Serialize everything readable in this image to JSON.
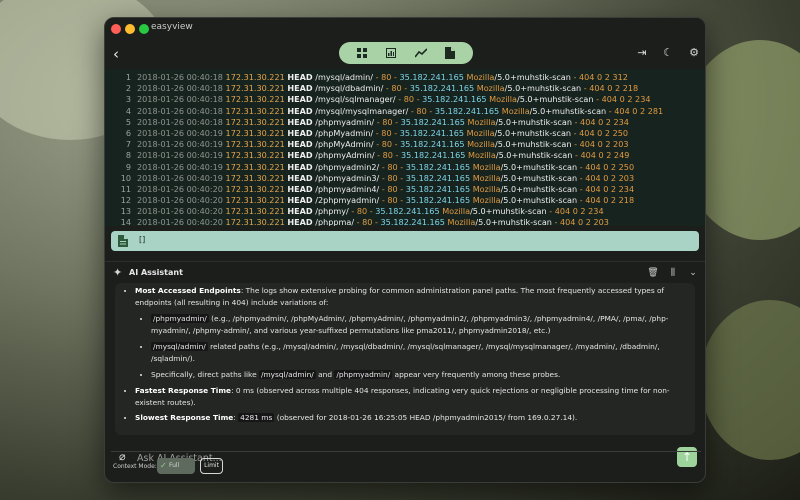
{
  "app": {
    "title": "easyview"
  },
  "log_lines": [
    {
      "n": "1",
      "ts": "2018-01-26 00:40:18",
      "ip": "172.31.30.221",
      "method": "HEAD",
      "path": "/mysql/admin/",
      "dash": "-",
      "port": "80",
      "ip2": "35.182.241.165",
      "ua": "Mozilla",
      "ua2": "/5.0+muhstik-scan",
      "tail": "404 0 2 312"
    },
    {
      "n": "2",
      "ts": "2018-01-26 00:40:18",
      "ip": "172.31.30.221",
      "method": "HEAD",
      "path": "/mysql/dbadmin/",
      "dash": "-",
      "port": "80",
      "ip2": "35.182.241.165",
      "ua": "Mozilla",
      "ua2": "/5.0+muhstik-scan",
      "tail": "404 0 2 218"
    },
    {
      "n": "3",
      "ts": "2018-01-26 00:40:18",
      "ip": "172.31.30.221",
      "method": "HEAD",
      "path": "/mysql/sqlmanager/",
      "dash": "-",
      "port": "80",
      "ip2": "35.182.241.165",
      "ua": "Mozilla",
      "ua2": "/5.0+muhstik-scan",
      "tail": "404 0 2 234"
    },
    {
      "n": "4",
      "ts": "2018-01-26 00:40:18",
      "ip": "172.31.30.221",
      "method": "HEAD",
      "path": "/mysql/mysqlmanager/",
      "dash": "-",
      "port": "80",
      "ip2": "35.182.241.165",
      "ua": "Mozilla",
      "ua2": "/5.0+muhstik-scan",
      "tail": "404 0 2 281"
    },
    {
      "n": "5",
      "ts": "2018-01-26 00:40:18",
      "ip": "172.31.30.221",
      "method": "HEAD",
      "path": "/phpmyadmin/",
      "dash": "-",
      "port": "80",
      "ip2": "35.182.241.165",
      "ua": "Mozilla",
      "ua2": "/5.0+muhstik-scan",
      "tail": "404 0 2 234"
    },
    {
      "n": "6",
      "ts": "2018-01-26 00:40:19",
      "ip": "172.31.30.221",
      "method": "HEAD",
      "path": "/phpMyadmin/",
      "dash": "-",
      "port": "80",
      "ip2": "35.182.241.165",
      "ua": "Mozilla",
      "ua2": "/5.0+muhstik-scan",
      "tail": "404 0 2 250"
    },
    {
      "n": "7",
      "ts": "2018-01-26 00:40:19",
      "ip": "172.31.30.221",
      "method": "HEAD",
      "path": "/phpMyAdmin/",
      "dash": "-",
      "port": "80",
      "ip2": "35.182.241.165",
      "ua": "Mozilla",
      "ua2": "/5.0+muhstik-scan",
      "tail": "404 0 2 203"
    },
    {
      "n": "8",
      "ts": "2018-01-26 00:40:19",
      "ip": "172.31.30.221",
      "method": "HEAD",
      "path": "/phpmyAdmin/",
      "dash": "-",
      "port": "80",
      "ip2": "35.182.241.165",
      "ua": "Mozilla",
      "ua2": "/5.0+muhstik-scan",
      "tail": "404 0 2 249"
    },
    {
      "n": "9",
      "ts": "2018-01-26 00:40:19",
      "ip": "172.31.30.221",
      "method": "HEAD",
      "path": "/phpmyadmin2/",
      "dash": "-",
      "port": "80",
      "ip2": "35.182.241.165",
      "ua": "Mozilla",
      "ua2": "/5.0+muhstik-scan",
      "tail": "404 0 2 250"
    },
    {
      "n": "10",
      "ts": "2018-01-26 00:40:19",
      "ip": "172.31.30.221",
      "method": "HEAD",
      "path": "/phpmyadmin3/",
      "dash": "-",
      "port": "80",
      "ip2": "35.182.241.165",
      "ua": "Mozilla",
      "ua2": "/5.0+muhstik-scan",
      "tail": "404 0 2 203"
    },
    {
      "n": "11",
      "ts": "2018-01-26 00:40:20",
      "ip": "172.31.30.221",
      "method": "HEAD",
      "path": "/phpmyadmin4/",
      "dash": "-",
      "port": "80",
      "ip2": "35.182.241.165",
      "ua": "Mozilla",
      "ua2": "/5.0+muhstik-scan",
      "tail": "404 0 2 234"
    },
    {
      "n": "12",
      "ts": "2018-01-26 00:40:20",
      "ip": "172.31.30.221",
      "method": "HEAD",
      "path": "/2phpmyadmin/",
      "dash": "-",
      "port": "80",
      "ip2": "35.182.241.165",
      "ua": "Mozilla",
      "ua2": "/5.0+muhstik-scan",
      "tail": "404 0 2 218"
    },
    {
      "n": "13",
      "ts": "2018-01-26 00:40:20",
      "ip": "172.31.30.221",
      "method": "HEAD",
      "path": "/phpmy/",
      "dash": "-",
      "port": "80",
      "ip2": "35.182.241.165",
      "ua": "Mozilla",
      "ua2": "/5.0+muhstik-scan",
      "tail": "404 0 2 234"
    },
    {
      "n": "14",
      "ts": "2018-01-26 00:40:20",
      "ip": "172.31.30.221",
      "method": "HEAD",
      "path": "/phppma/",
      "dash": "-",
      "port": "80",
      "ip2": "35.182.241.165",
      "ua": "Mozilla",
      "ua2": "/5.0+muhstik-scan",
      "tail": "404 0 2 203"
    }
  ],
  "filter": {
    "text": "[]"
  },
  "ai": {
    "title": "AI Assistant",
    "resp": {
      "b1_title": "Most Accessed Endpoints",
      "b1_text": ": The logs show extensive probing for common administration panel paths. The most frequently accessed types of endpoints (all resulting in 404) include variations of:",
      "s1_code": "/phpmyadmin/",
      "s1_text": "(e.g., /phpmyadmin/, /phpMyAdmin/, /phpmyAdmin/, /phpmyadmin2/, /phpmyadmin3/, /phpmyadmin4/, /PMA/, /pma/, /php-myadmin/, /phpmy-admin/, and various year-suffixed permutations like pma2011/, phpmyadmin2018/, etc.)",
      "s2_code": "/mysql/admin/",
      "s2_text": "related paths (e.g., /mysql/admin/, /mysql/dbadmin/, /mysql/sqlmanager/, /mysql/mysqlmanager/, /myadmin/, /dbadmin/, /sqladmin/).",
      "s3_pre": "Specifically, direct paths like",
      "s3_code1": "/mysql/admin/",
      "s3_mid": "and",
      "s3_code2": "/phpmyadmin/",
      "s3_post": "appear very frequently among these probes.",
      "b2_title": "Fastest Response Time",
      "b2_text": ": 0 ms (observed across multiple 404 responses, indicating very quick rejections or negligible processing time for non-existent routes).",
      "b3_title": "Slowest Response Time",
      "b3_code": "4281 ms",
      "b3_text": "(observed for 2018-01-26 16:25:05 HEAD /phpmyadmin2015/ from 169.0.27.14)."
    },
    "input_placeholder": "Ask AI Assistant...",
    "context_mode_label": "Context Mode:",
    "mode_full": "Full",
    "mode_limit": "Limit"
  }
}
